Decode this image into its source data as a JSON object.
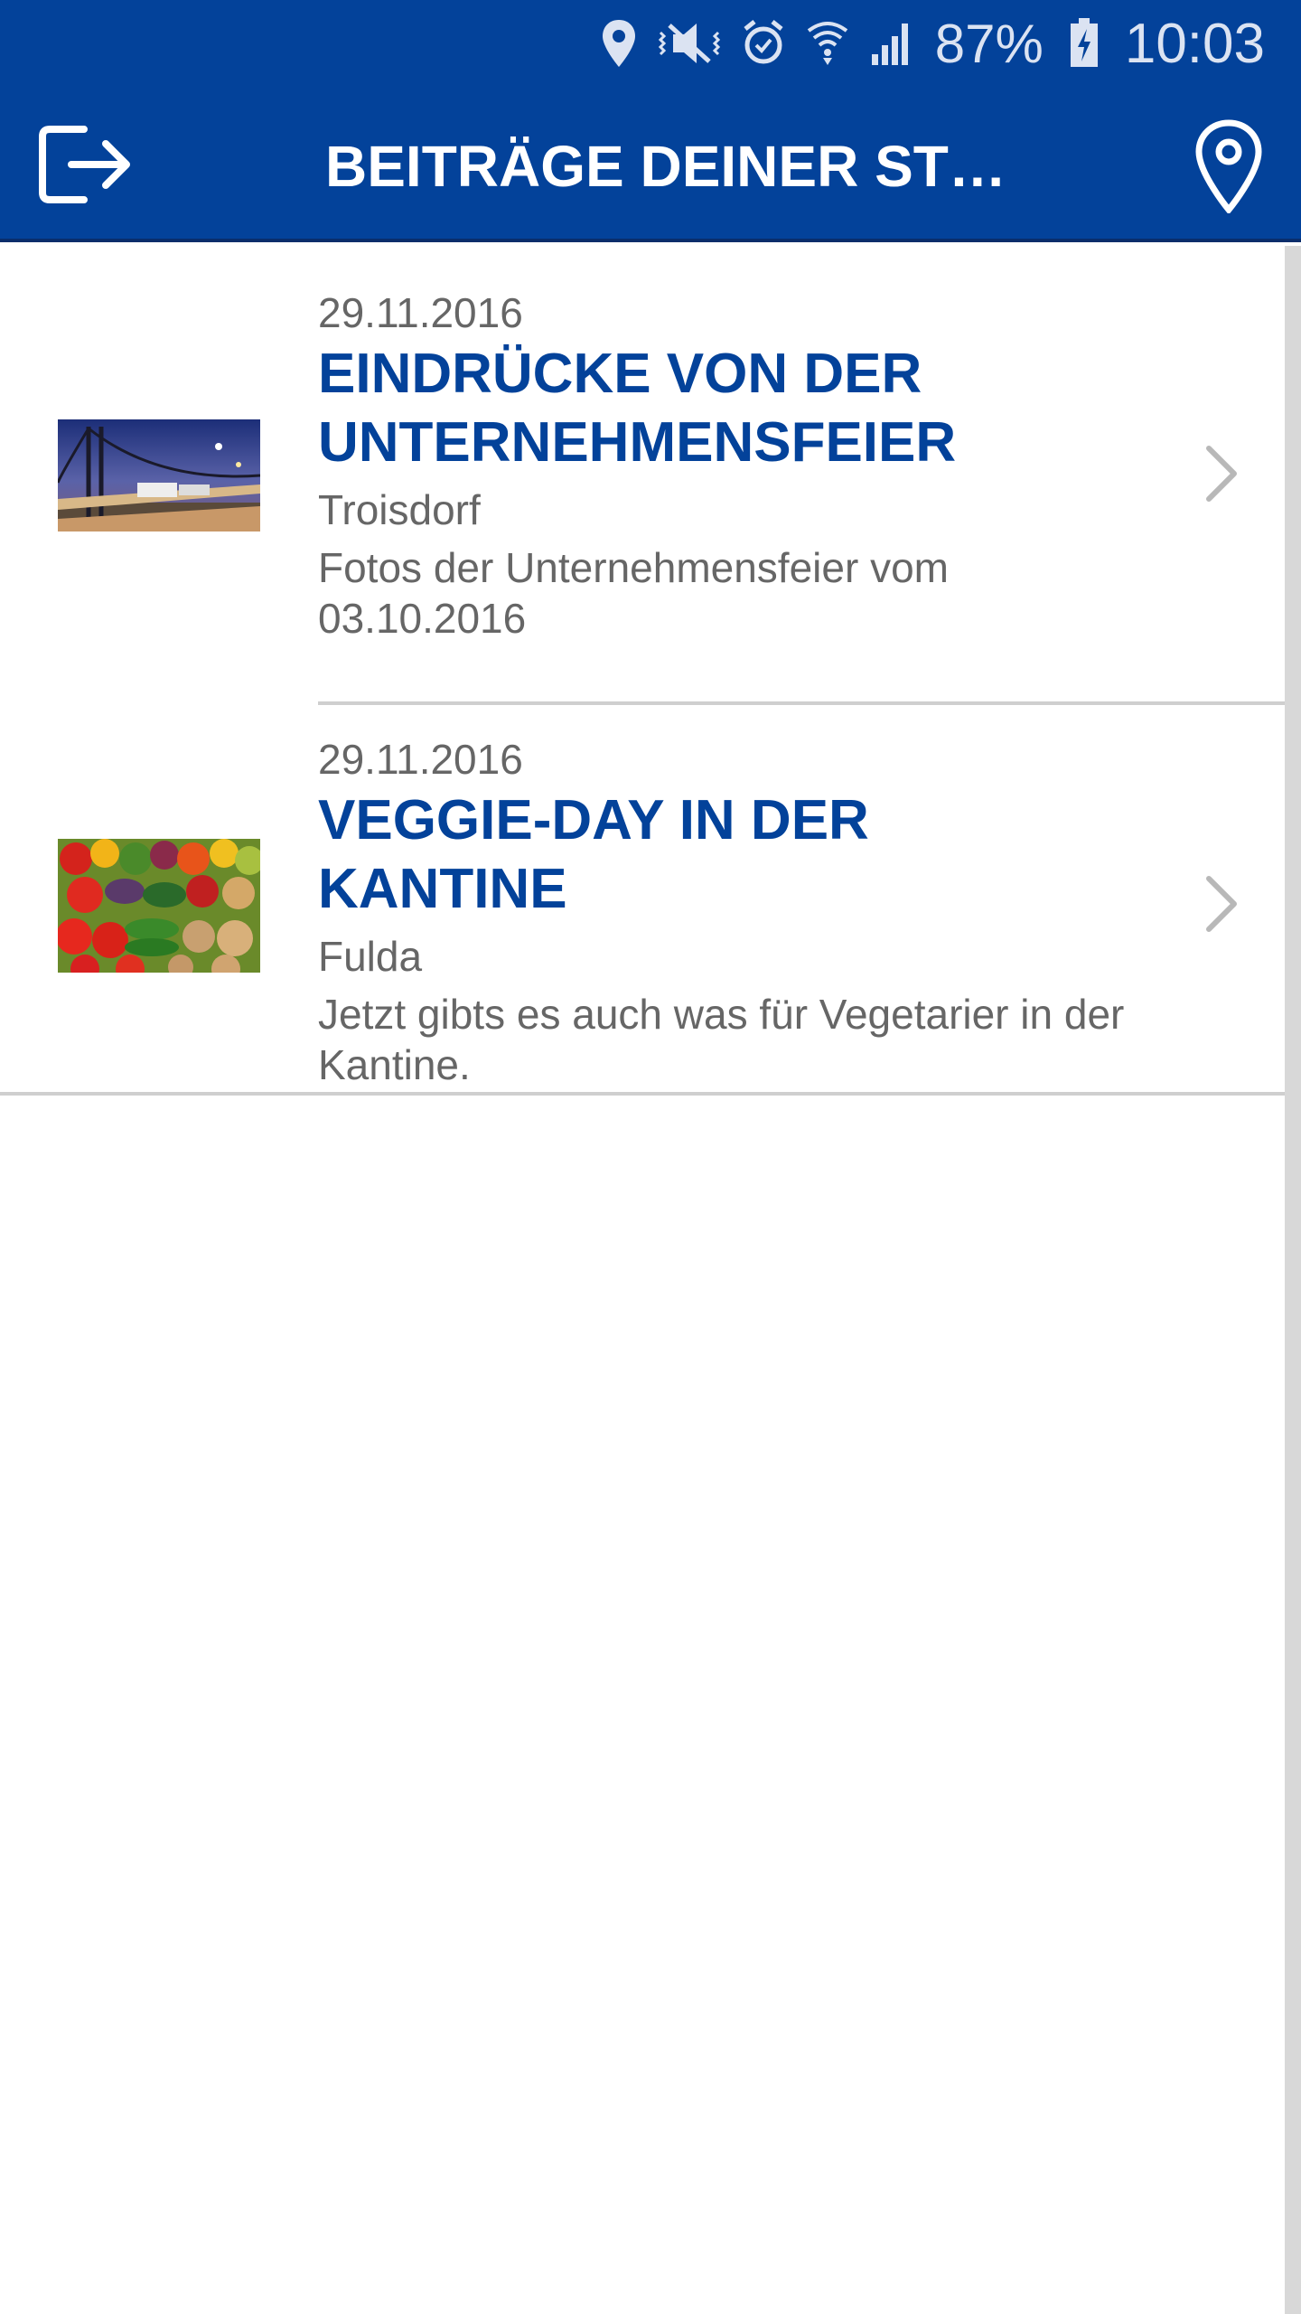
{
  "status_bar": {
    "battery_percent": "87%",
    "time": "10:03",
    "icons": [
      "location-icon",
      "vibrate-mute-icon",
      "alarm-icon",
      "wifi-icon",
      "signal-icon",
      "battery-charging-icon"
    ]
  },
  "app_bar": {
    "title": "BEITRÄGE DEINER ST…",
    "left_icon": "logout-icon",
    "right_icon": "map-pin-icon"
  },
  "feed": {
    "items": [
      {
        "date": "29.11.2016",
        "title": "EINDRÜCKE VON DER UNTERNEHMENSFEIER",
        "location": "Troisdorf",
        "excerpt": "Fotos der Unternehmensfeier vom 03.10.2016",
        "thumbnail": "bridge-night-photo"
      },
      {
        "date": "29.11.2016",
        "title": "VEGGIE-DAY IN DER KANTINE",
        "location": "Fulda",
        "excerpt": "Jetzt gibts es auch was für Vegetarier in der Kantine.",
        "thumbnail": "vegetables-photo"
      }
    ]
  },
  "colors": {
    "primary": "#03429a",
    "headline": "#03429a",
    "secondary_text": "#666666",
    "divider": "#cfcfcf"
  }
}
